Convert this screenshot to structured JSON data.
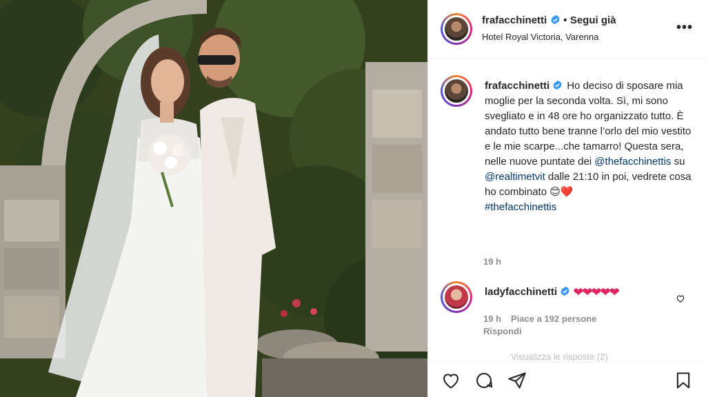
{
  "header": {
    "username": "frafacchinetti",
    "separator": "•",
    "follow_label": "Segui già",
    "location": "Hotel Royal Victoria, Varenna",
    "more_label": "•••"
  },
  "caption": {
    "username": "frafacchinetti",
    "text_1": "Ho deciso di sposare mia moglie per la seconda volta. Sì, mi sono svegliato e in 48 ore ho organizzato tutto. È andato tutto bene tranne l’orlo del mio vestito e le mie scarpe...che tamarro! Questa sera, nelle nuove puntate dei ",
    "mention_1": "@thefacchinettis",
    "text_2": " su ",
    "mention_2": "@realtimetvit",
    "text_3": " dalle 21:10 in poi, vedrete cosa ho combinato 😊❤️",
    "hashtag": "#thefacchinettis",
    "time": "19 h"
  },
  "comment": {
    "username": "ladyfacchinetti",
    "text": "❤❤❤❤❤",
    "time": "19 h",
    "likes": "Piace a 192 persone",
    "reply": "Rispondi",
    "view_replies": "Visualizza le risposte (2)"
  },
  "icons": {
    "like": "heart-icon",
    "comment": "comment-icon",
    "share": "share-icon",
    "save": "bookmark-icon"
  },
  "colors": {
    "verified": "#3897f0",
    "link": "#00376b",
    "heart": "#e0245e",
    "muted": "#8e8e8e"
  }
}
